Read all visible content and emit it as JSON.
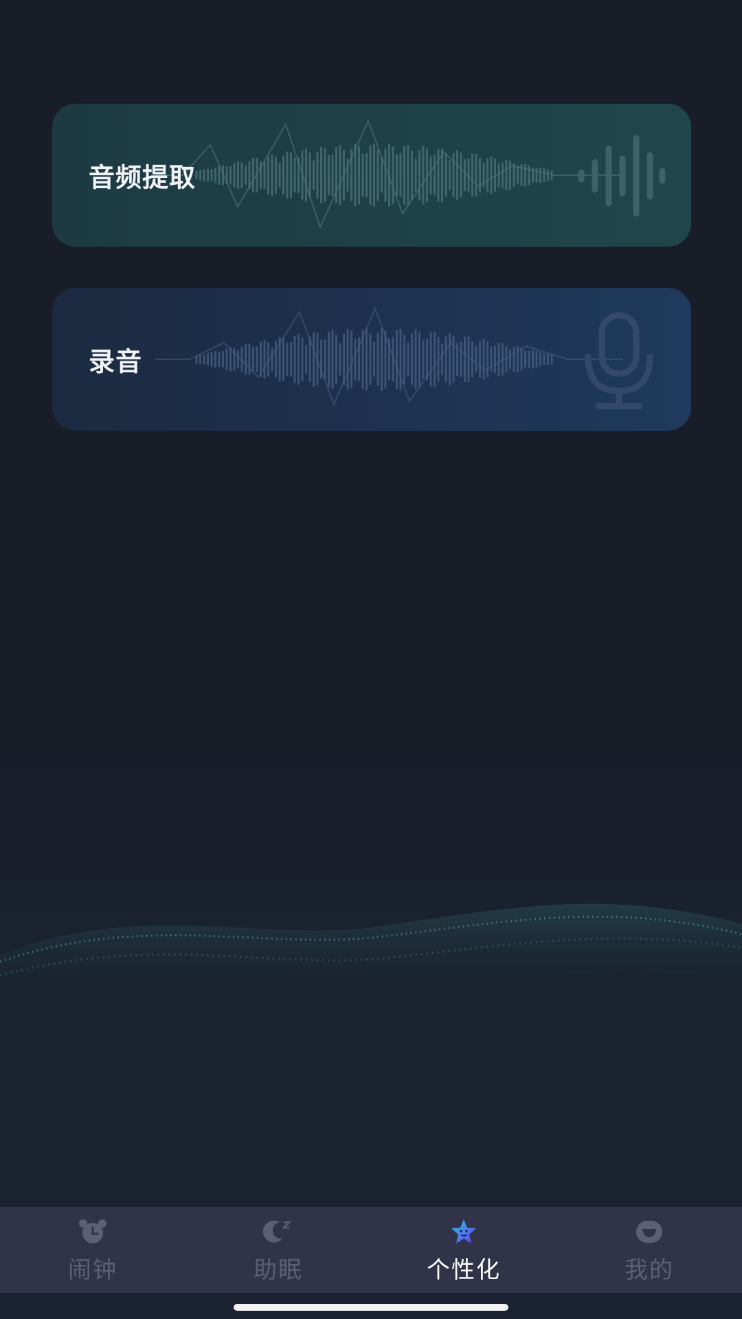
{
  "cards": [
    {
      "label": "音频提取",
      "icon": "waveform-icon"
    },
    {
      "label": "录音",
      "icon": "microphone-icon"
    }
  ],
  "tabs": [
    {
      "label": "闹钟",
      "icon": "alarm-clock-icon",
      "active": false
    },
    {
      "label": "助眠",
      "icon": "moon-sleep-icon",
      "active": false
    },
    {
      "label": "个性化",
      "icon": "star-face-icon",
      "active": true
    },
    {
      "label": "我的",
      "icon": "smile-icon",
      "active": false
    }
  ],
  "colors": {
    "background": "#181c26",
    "tabbar": "#313449",
    "tab_inactive": "#5d6074",
    "tab_active": "#ffffff",
    "card_audio": "#1f4048",
    "card_record": "#1d3250"
  }
}
